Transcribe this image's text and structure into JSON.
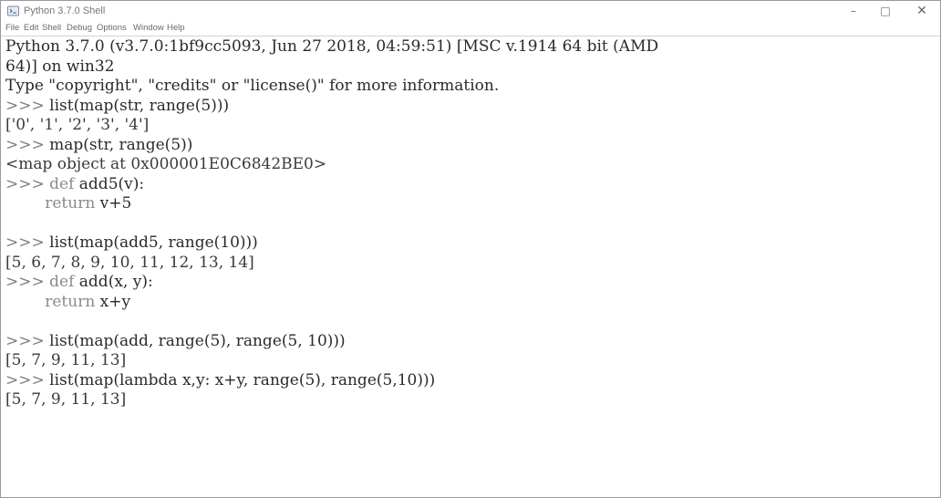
{
  "window": {
    "title": "Python 3.7.0 Shell",
    "minimize_glyph": "–",
    "maximize_glyph": "□",
    "close_glyph": "✕"
  },
  "menu": [
    "File",
    "Edit",
    "Shell",
    "Debug",
    "Options",
    "Window",
    "Help"
  ],
  "shell": {
    "banner_1": "Python 3.7.0 (v3.7.0:1bf9cc5093, Jun 27 2018, 04:59:51) [MSC v.1914 64 bit (AMD",
    "banner_2": "64)] on win32",
    "banner_3": "Type \"copyright\", \"credits\" or \"license()\" for more information.",
    "prompt": ">>> ",
    "def_keyword": "def",
    "return_keyword": "return",
    "indent": "        ",
    "in_1": "list(map(str, range(5)))",
    "out_1": "['0', '1', '2', '3', '4']",
    "in_2": "map(str, range(5))",
    "out_2": "<map object at 0x000001E0C6842BE0>",
    "in_3_def": " add5(v):",
    "in_3_body": " v+5",
    "in_4": "list(map(add5, range(10)))",
    "out_4": "[5, 6, 7, 8, 9, 10, 11, 12, 13, 14]",
    "in_5_def": " add(x, y):",
    "in_5_body": " x+y",
    "in_6": "list(map(add, range(5), range(5, 10)))",
    "out_6": "[5, 7, 9, 11, 13]",
    "in_7": "list(map(lambda x,y: x+y, range(5), range(5,10)))",
    "out_7": "[5, 7, 9, 11, 13]"
  }
}
